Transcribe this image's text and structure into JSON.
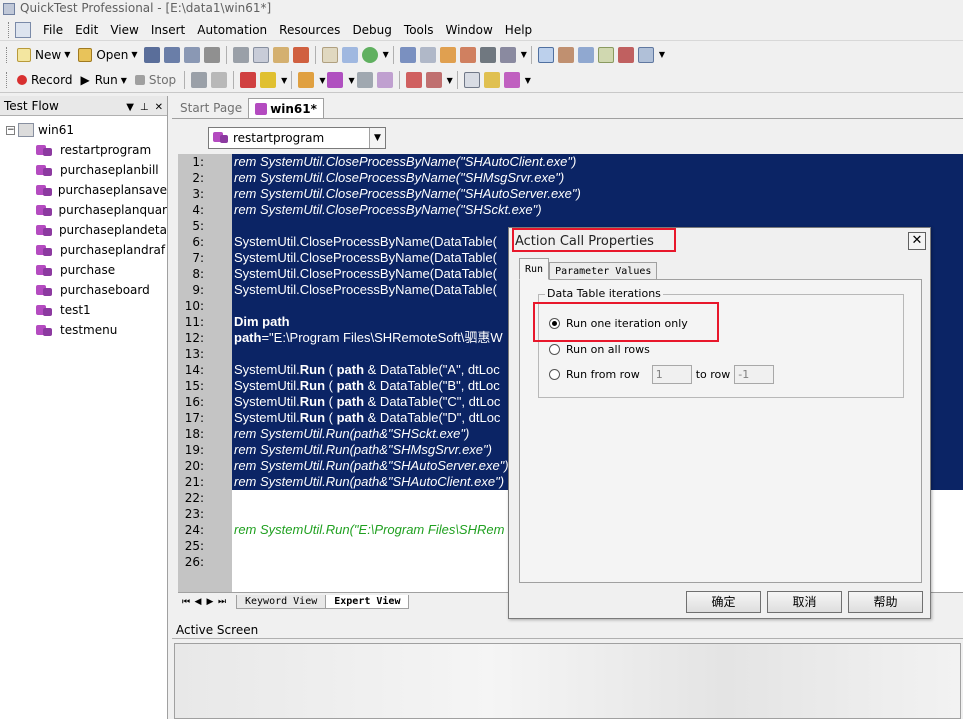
{
  "window": {
    "title": "QuickTest Professional - [E:\\data1\\win61*]"
  },
  "menu": [
    "File",
    "Edit",
    "View",
    "Insert",
    "Automation",
    "Resources",
    "Debug",
    "Tools",
    "Window",
    "Help"
  ],
  "toolbar1": {
    "new_label": "New",
    "open_label": "Open"
  },
  "toolbar2": {
    "record_label": "Record",
    "run_label": "Run",
    "stop_label": "Stop"
  },
  "test_flow": {
    "title": "Test Flow",
    "root": "win61",
    "items": [
      "restartprogram",
      "purchaseplanbill",
      "purchaseplansave",
      "purchaseplanquar",
      "purchaseplandeta",
      "purchaseplandraf",
      "purchase",
      "purchaseboard",
      "test1",
      "testmenu"
    ]
  },
  "doc_tabs": [
    "Start Page",
    "win61*"
  ],
  "action_combo": "restartprogram",
  "line_numbers": [
    "1:",
    "2:",
    "3:",
    "4:",
    "5:",
    "6:",
    "7:",
    "8:",
    "9:",
    "10:",
    "11:",
    "12:",
    "13:",
    "14:",
    "15:",
    "16:",
    "17:",
    "18:",
    "19:",
    "20:",
    "21:",
    "22:",
    "23:",
    "24:",
    "25:",
    "26:"
  ],
  "code": {
    "l1": "rem SystemUtil.CloseProcessByName(\"SHAutoClient.exe\")",
    "l2": "rem SystemUtil.CloseProcessByName(\"SHMsgSrvr.exe\")",
    "l3": "rem SystemUtil.CloseProcessByName(\"SHAutoServer.exe\")",
    "l4": "rem SystemUtil.CloseProcessByName(\"SHSckt.exe\")",
    "l6": "SystemUtil.CloseProcessByName(DataTable(",
    "l7": "SystemUtil.CloseProcessByName(DataTable(",
    "l8": "SystemUtil.CloseProcessByName(DataTable(",
    "l9": "SystemUtil.CloseProcessByName(DataTable(",
    "l11_kw": "Dim path",
    "l12_kw": "path",
    "l12_rest": "=\"E:\\Program Files\\SHRemoteSoft\\驷惠W",
    "run_prefix": "SystemUtil.",
    "run_kw": "Run",
    "path_kw": "path",
    "l14_rest": " & DataTable(\"A\", dtLoc",
    "l15_rest": " & DataTable(\"B\", dtLoc",
    "l16_rest": " & DataTable(\"C\", dtLoc",
    "l17_rest": " & DataTable(\"D\", dtLoc",
    "l18": "rem SystemUtil.Run(path&\"SHSckt.exe\")",
    "l19": "rem SystemUtil.Run(path&\"SHMsgSrvr.exe\")",
    "l20": "rem SystemUtil.Run(path&\"SHAutoServer.exe\")",
    "l21": "rem SystemUtil.Run(path&\"SHAutoClient.exe\")",
    "l24": "rem SystemUtil.Run(\"E:\\Program Files\\SHRem"
  },
  "view_tabs": {
    "keyword": "Keyword View",
    "expert": "Expert View"
  },
  "active_screen": {
    "title": "Active Screen"
  },
  "dialog": {
    "title": "Action Call Properties",
    "tabs": [
      "Run",
      "Parameter Values"
    ],
    "group_label": "Data Table iterations",
    "option_one": "Run one iteration only",
    "option_all": "Run on all rows",
    "option_range": "Run from row",
    "from_row": "1",
    "to_label": "to row",
    "to_row": "-1",
    "ok": "确定",
    "cancel": "取消",
    "help": "帮助"
  }
}
